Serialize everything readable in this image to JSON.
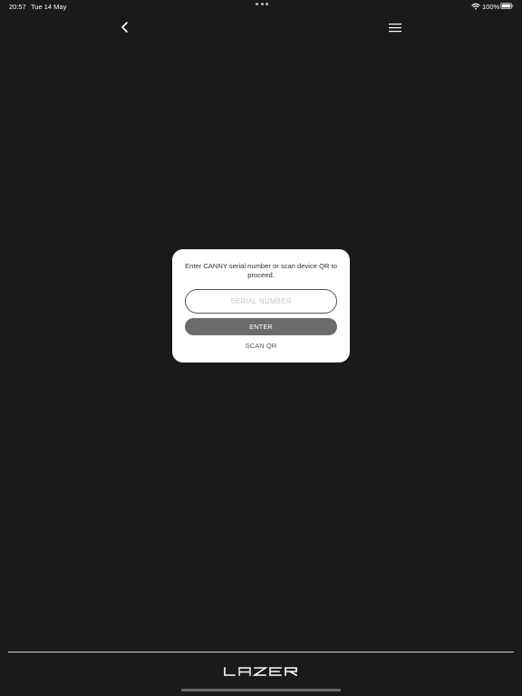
{
  "status_bar": {
    "time": "20:57",
    "date": "Tue 14 May",
    "battery_percent": "100%"
  },
  "nav": {
    "back_icon": "chevron-left",
    "menu_icon": "hamburger-menu"
  },
  "dialog": {
    "message": "Enter CANNY serial number or scan device QR to proceed.",
    "serial_placeholder": "SERIAL NUMBER",
    "serial_value": "",
    "enter_label": "ENTER",
    "scan_qr_label": "SCAN QR"
  },
  "footer": {
    "brand": "LAZER"
  },
  "colors": {
    "background": "#1b1a1a",
    "dialog_bg": "#ffffff",
    "enter_button": "#6d6b69",
    "divider": "#d0d0d0"
  }
}
